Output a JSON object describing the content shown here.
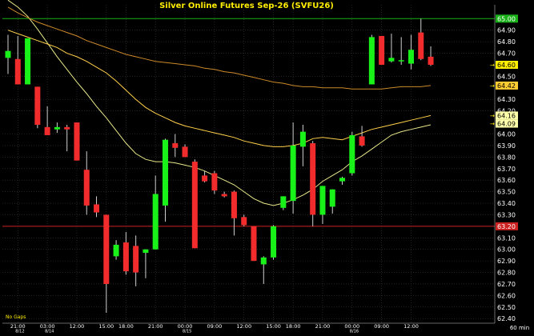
{
  "title": "Silver Online Futures  Sep-26  (SVFU26)",
  "timeframe": "60 min",
  "gap_label": "No Gaps",
  "colors": {
    "background": "#000000",
    "grid": "#3a3a3a",
    "up": "#19f219",
    "down": "#f22c2c",
    "wick": "#d0d0d0",
    "title": "#ffee00",
    "axis_text": "#ffffff",
    "ma_fast": "#e8e88a",
    "ma_mid": "#ffd04a",
    "ma_slow": "#cc8a28",
    "line_high": "#19b019",
    "line_low": "#cc2222"
  },
  "chart_data": {
    "type": "candlestick",
    "title": "Silver Online Futures  Sep-26  (SVFU26)",
    "ylim": [
      62.36,
      65.12
    ],
    "y_ticks": [
      "62.40",
      "62.50",
      "62.60",
      "62.70",
      "62.80",
      "62.90",
      "63.00",
      "63.10",
      "63.30",
      "63.40",
      "63.50",
      "63.60",
      "63.70",
      "63.80",
      "63.90",
      "64.00",
      "64.20",
      "64.30",
      "64.50",
      "64.70",
      "64.80",
      "64.90"
    ],
    "x_ticks": [
      {
        "idx": 1,
        "time": "21:00",
        "date": "8/12"
      },
      {
        "idx": 4,
        "time": "03:00",
        "date": "8/14"
      },
      {
        "idx": 7,
        "time": "12:00"
      },
      {
        "idx": 10,
        "time": "15:00"
      },
      {
        "idx": 12,
        "time": "18:00"
      },
      {
        "idx": 15,
        "time": "21:00"
      },
      {
        "idx": 18,
        "time": "00:00",
        "date": "8/15"
      },
      {
        "idx": 21,
        "time": "09:00"
      },
      {
        "idx": 24,
        "time": "12:00"
      },
      {
        "idx": 27,
        "time": "15:00"
      },
      {
        "idx": 29,
        "time": "18:00"
      },
      {
        "idx": 32,
        "time": "21:00"
      },
      {
        "idx": 35,
        "time": "00:00",
        "date": "8/16"
      },
      {
        "idx": 38,
        "time": "09:00"
      },
      {
        "idx": 41,
        "time": "12:00"
      }
    ],
    "candles": [
      {
        "o": 64.66,
        "h": 64.86,
        "l": 64.52,
        "c": 64.72
      },
      {
        "o": 64.65,
        "h": 64.85,
        "l": 64.43,
        "c": 64.43
      },
      {
        "o": 64.43,
        "h": 64.83,
        "l": 64.43,
        "c": 64.83
      },
      {
        "o": 64.41,
        "h": 64.41,
        "l": 64.05,
        "c": 64.08
      },
      {
        "o": 64.06,
        "h": 64.24,
        "l": 64.0,
        "c": 63.99
      },
      {
        "o": 64.04,
        "h": 64.1,
        "l": 64.01,
        "c": 64.06
      },
      {
        "o": 64.06,
        "h": 64.08,
        "l": 63.85,
        "c": 64.04
      },
      {
        "o": 64.1,
        "h": 64.1,
        "l": 63.78,
        "c": 63.77
      },
      {
        "o": 63.69,
        "h": 63.85,
        "l": 63.3,
        "c": 63.38
      },
      {
        "o": 63.39,
        "h": 63.46,
        "l": 63.28,
        "c": 63.32
      },
      {
        "o": 63.3,
        "h": 63.3,
        "l": 62.45,
        "c": 62.7
      },
      {
        "o": 62.94,
        "h": 63.08,
        "l": 62.91,
        "c": 63.04
      },
      {
        "o": 63.06,
        "h": 63.15,
        "l": 62.78,
        "c": 62.81
      },
      {
        "o": 63.03,
        "h": 63.12,
        "l": 62.68,
        "c": 62.8
      },
      {
        "o": 62.97,
        "h": 63.0,
        "l": 62.75,
        "c": 63.0
      },
      {
        "o": 63.0,
        "h": 63.64,
        "l": 63.0,
        "c": 63.48
      },
      {
        "o": 63.38,
        "h": 63.96,
        "l": 63.24,
        "c": 63.95
      },
      {
        "o": 63.92,
        "h": 64.0,
        "l": 63.8,
        "c": 63.88
      },
      {
        "o": 63.89,
        "h": 63.91,
        "l": 63.8,
        "c": 63.8
      },
      {
        "o": 63.76,
        "h": 63.78,
        "l": 63.01,
        "c": 63.01
      },
      {
        "o": 63.64,
        "h": 63.68,
        "l": 63.58,
        "c": 63.59
      },
      {
        "o": 63.66,
        "h": 63.68,
        "l": 63.48,
        "c": 63.51
      },
      {
        "o": 63.48,
        "h": 63.5,
        "l": 63.45,
        "c": 63.46
      },
      {
        "o": 63.5,
        "h": 63.51,
        "l": 63.12,
        "c": 63.27
      },
      {
        "o": 63.28,
        "h": 63.3,
        "l": 63.2,
        "c": 63.21
      },
      {
        "o": 63.2,
        "h": 63.2,
        "l": 62.9,
        "c": 62.9
      },
      {
        "o": 62.87,
        "h": 62.94,
        "l": 62.7,
        "c": 62.93
      },
      {
        "o": 62.93,
        "h": 63.21,
        "l": 62.91,
        "c": 63.2
      },
      {
        "o": 63.36,
        "h": 63.46,
        "l": 63.34,
        "c": 63.46
      },
      {
        "o": 63.42,
        "h": 64.1,
        "l": 63.31,
        "c": 63.9
      },
      {
        "o": 63.89,
        "h": 64.08,
        "l": 63.72,
        "c": 64.02
      },
      {
        "o": 63.92,
        "h": 63.94,
        "l": 63.2,
        "c": 63.3
      },
      {
        "o": 63.3,
        "h": 63.55,
        "l": 63.22,
        "c": 63.55
      },
      {
        "o": 63.37,
        "h": 63.52,
        "l": 63.31,
        "c": 63.52
      },
      {
        "o": 63.59,
        "h": 63.63,
        "l": 63.56,
        "c": 63.62
      },
      {
        "o": 63.66,
        "h": 64.02,
        "l": 63.64,
        "c": 63.99
      },
      {
        "o": 63.98,
        "h": 64.07,
        "l": 63.89,
        "c": 63.9
      },
      {
        "o": 64.43,
        "h": 64.86,
        "l": 64.43,
        "c": 64.84
      },
      {
        "o": 64.85,
        "h": 64.85,
        "l": 64.6,
        "c": 64.6
      },
      {
        "o": 64.63,
        "h": 64.87,
        "l": 64.62,
        "c": 64.66
      },
      {
        "o": 64.63,
        "h": 64.84,
        "l": 64.6,
        "c": 64.64
      },
      {
        "o": 64.61,
        "h": 64.86,
        "l": 64.56,
        "c": 64.73
      },
      {
        "o": 64.88,
        "h": 65.0,
        "l": 64.64,
        "c": 64.65
      },
      {
        "o": 64.67,
        "h": 64.76,
        "l": 64.59,
        "c": 64.6
      }
    ],
    "moving_averages": [
      {
        "color_key": "ma_fast",
        "values": [
          65.16,
          65.1,
          65.02,
          64.91,
          64.79,
          64.67,
          64.56,
          64.45,
          64.35,
          64.24,
          64.14,
          64.03,
          63.92,
          63.83,
          63.78,
          63.76,
          63.76,
          63.75,
          63.73,
          63.71,
          63.68,
          63.64,
          63.6,
          63.56,
          63.5,
          63.44,
          63.4,
          63.38,
          63.4,
          63.43,
          63.47,
          63.52,
          63.59,
          63.64,
          63.69,
          63.76,
          63.81,
          63.87,
          63.93,
          63.99,
          64.02,
          64.04,
          64.06,
          64.08
        ]
      },
      {
        "color_key": "ma_mid",
        "values": [
          64.9,
          64.87,
          64.84,
          64.81,
          64.78,
          64.75,
          64.7,
          64.67,
          64.63,
          64.58,
          64.53,
          64.46,
          64.38,
          64.3,
          64.23,
          64.18,
          64.14,
          64.1,
          64.07,
          64.05,
          64.03,
          64.01,
          63.99,
          63.97,
          63.94,
          63.92,
          63.9,
          63.89,
          63.89,
          63.9,
          63.92,
          63.96,
          63.97,
          63.96,
          63.95,
          63.98,
          64.01,
          64.04,
          64.06,
          64.08,
          64.1,
          64.12,
          64.14,
          64.16
        ]
      },
      {
        "color_key": "ma_slow",
        "values": [
          65.1,
          65.05,
          65.01,
          64.97,
          64.94,
          64.91,
          64.88,
          64.85,
          64.81,
          64.78,
          64.75,
          64.72,
          64.69,
          64.67,
          64.65,
          64.63,
          64.62,
          64.61,
          64.6,
          64.59,
          64.57,
          64.56,
          64.54,
          64.53,
          64.51,
          64.49,
          64.47,
          64.45,
          64.44,
          64.42,
          64.41,
          64.41,
          64.4,
          64.4,
          64.4,
          64.39,
          64.39,
          64.39,
          64.39,
          64.4,
          64.41,
          64.41,
          64.41,
          64.42
        ]
      }
    ],
    "horizontal_lines": [
      {
        "value": 65.0,
        "label": "65.00",
        "color_key": "line_high"
      },
      {
        "value": 63.2,
        "label": "63.20",
        "color_key": "line_low"
      }
    ],
    "price_labels": [
      {
        "value": 64.6,
        "label": "64.60",
        "bg": "#ffee00",
        "fg": "#000000"
      },
      {
        "value": 64.42,
        "label": "64.42",
        "bg": "#ffcc33",
        "fg": "#000000"
      },
      {
        "value": 64.16,
        "label": "64.16",
        "bg": "#ffffaa",
        "fg": "#000000"
      },
      {
        "value": 64.09,
        "label": "64.09",
        "bg": "#ffffaa",
        "fg": "#000000"
      }
    ]
  }
}
